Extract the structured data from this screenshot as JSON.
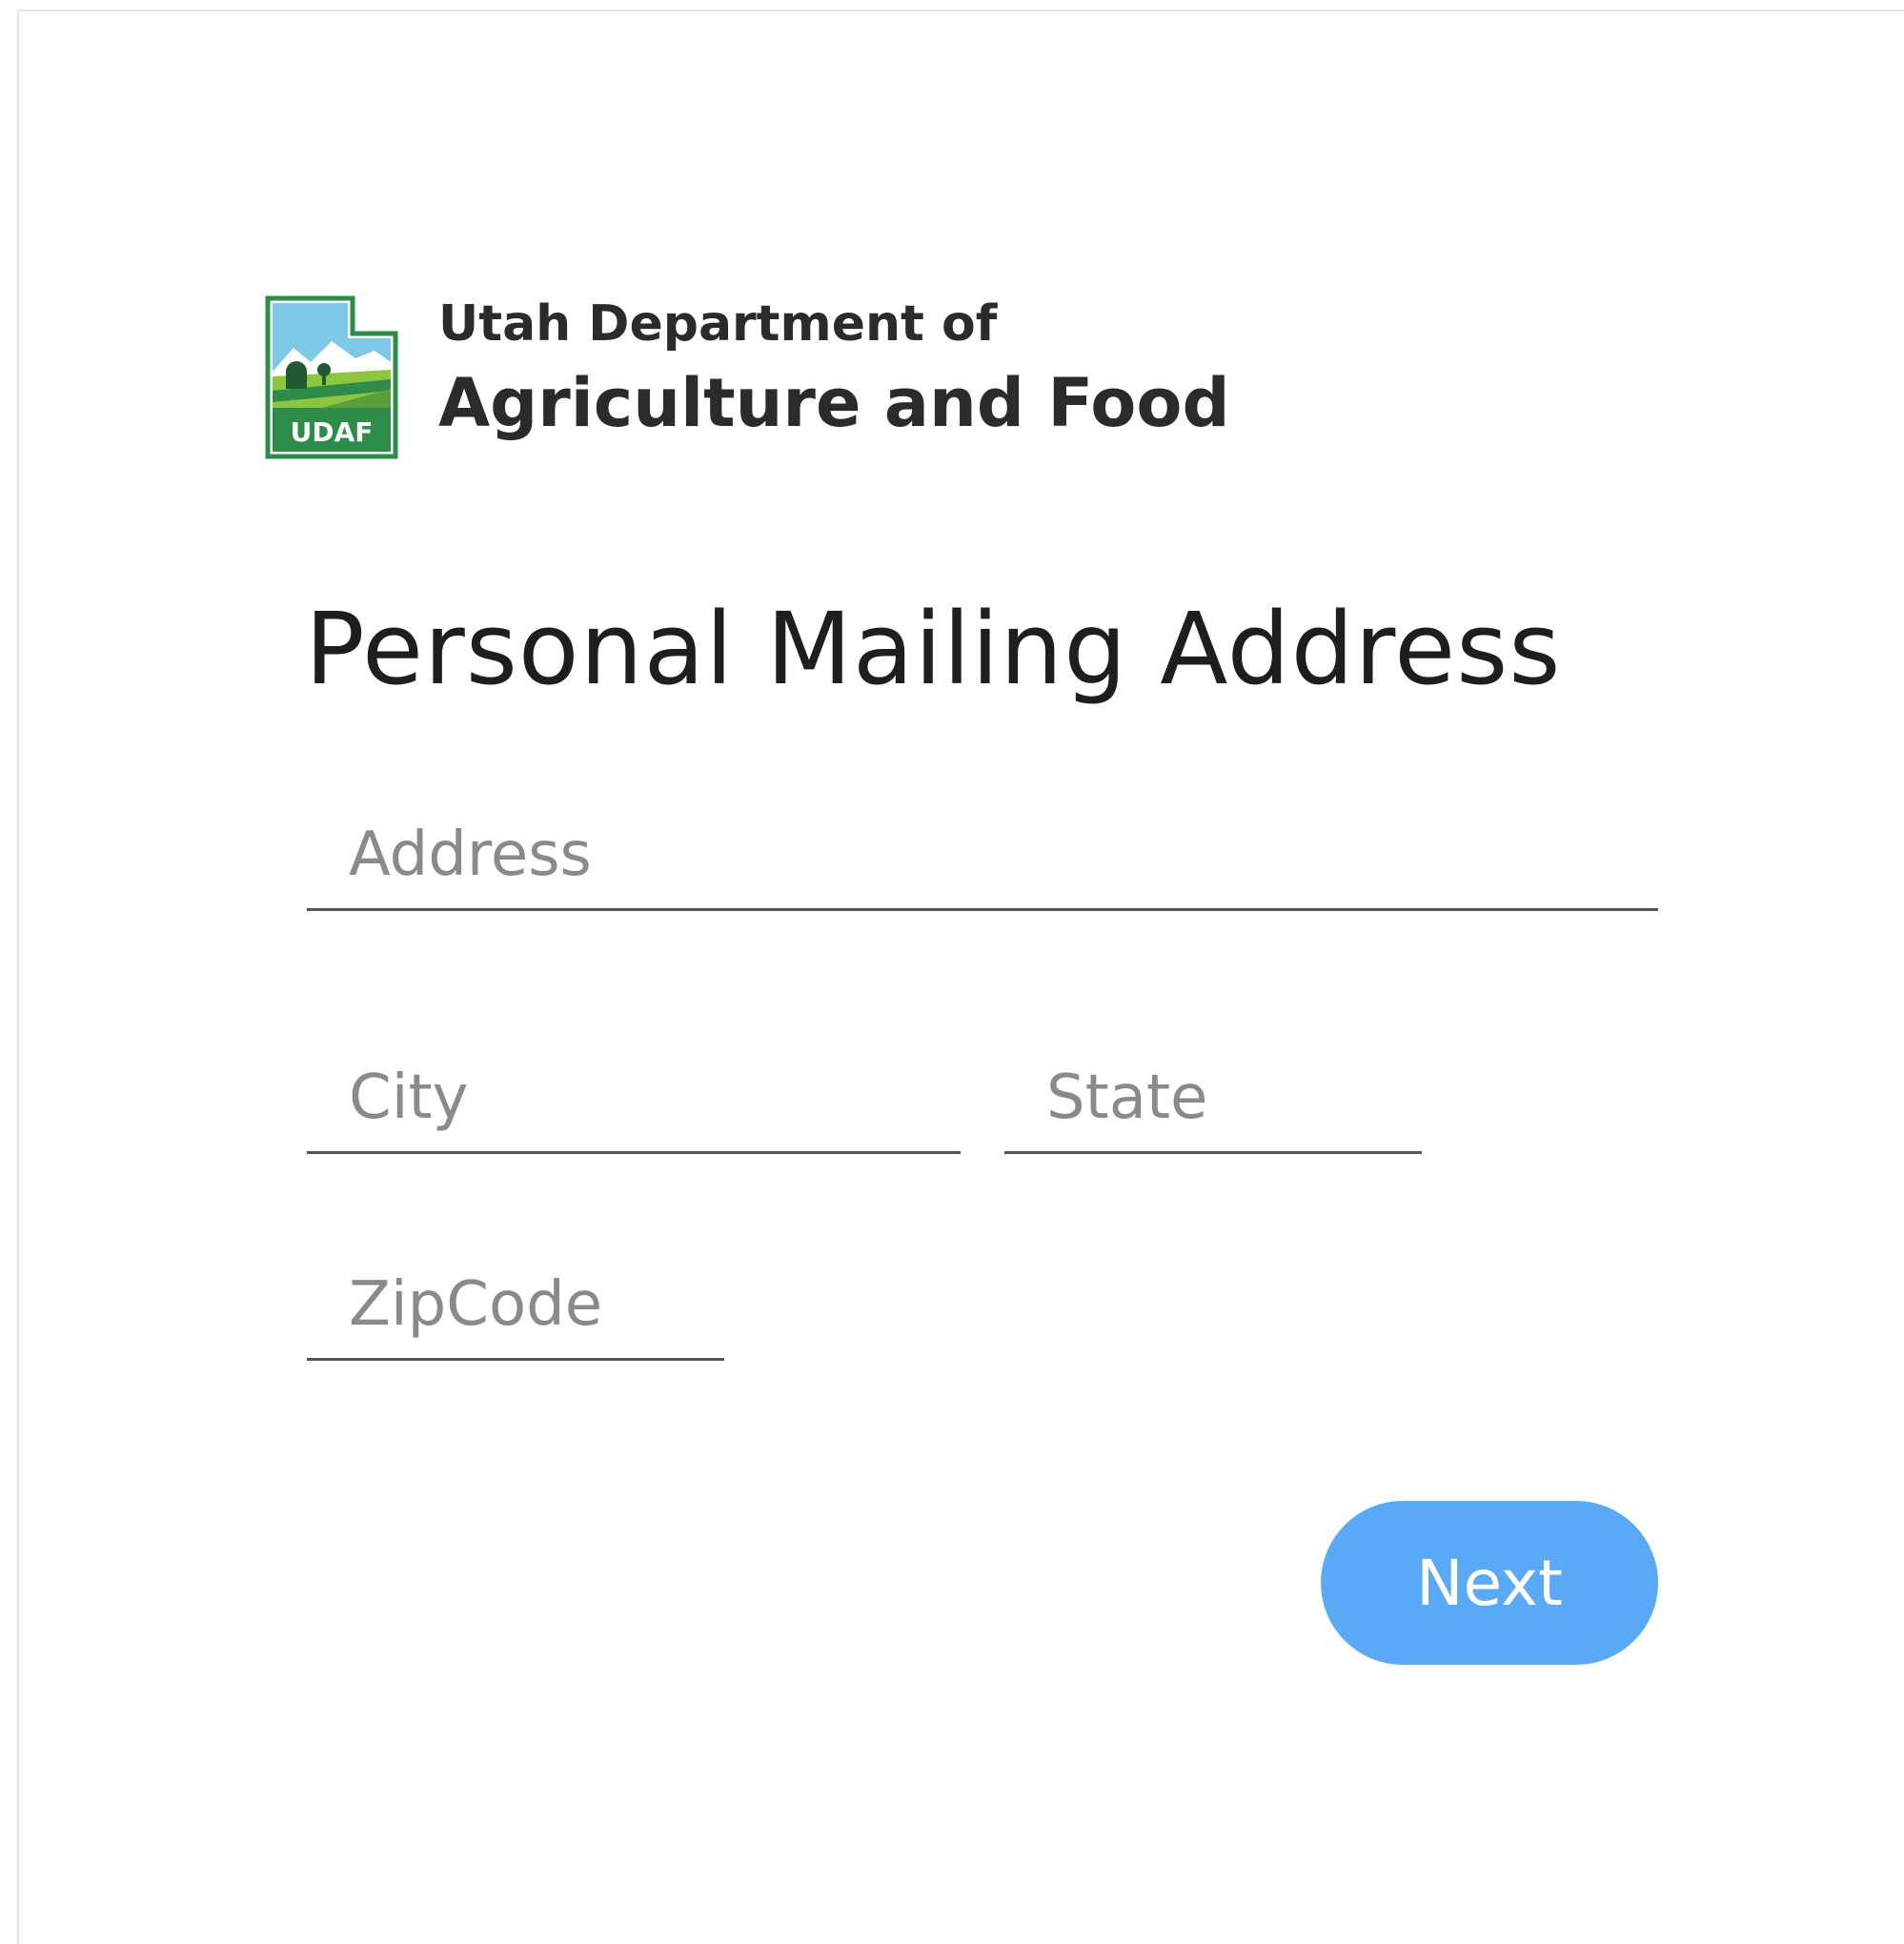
{
  "header": {
    "logo_label": "UDAF",
    "agency_line1": "Utah Department of",
    "agency_line2": "Agriculture and Food"
  },
  "main": {
    "title": "Personal Mailing Address",
    "fields": {
      "address": {
        "placeholder": "Address",
        "value": ""
      },
      "city": {
        "placeholder": "City",
        "value": ""
      },
      "state": {
        "placeholder": "State",
        "value": ""
      },
      "zip": {
        "placeholder": "ZipCode",
        "value": ""
      }
    },
    "next_label": "Next"
  },
  "colors": {
    "accent": "#5aa9f7",
    "logo_green": "#2e8b4a",
    "logo_sky": "#7fc8e8"
  }
}
